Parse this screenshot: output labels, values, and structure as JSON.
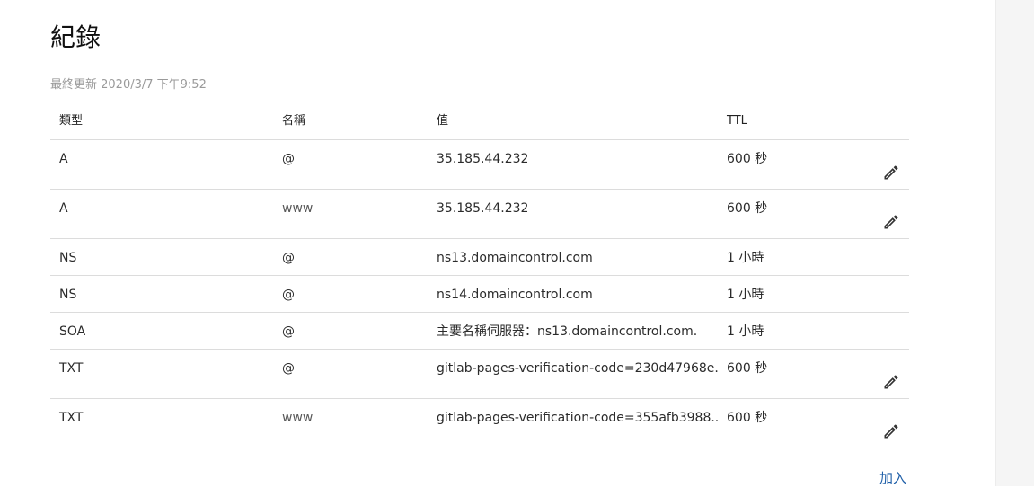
{
  "page": {
    "title": "紀錄",
    "last_updated": "最終更新 2020/3/7 下午9:52",
    "add_label": "加入"
  },
  "table": {
    "headers": {
      "type": "類型",
      "name": "名稱",
      "value": "值",
      "ttl": "TTL"
    },
    "rows": [
      {
        "type": "A",
        "name": "@",
        "value": "35.185.44.232",
        "ttl": "600 秒",
        "editable": true
      },
      {
        "type": "A",
        "name": "www",
        "value": "35.185.44.232",
        "ttl": "600 秒",
        "editable": true
      },
      {
        "type": "NS",
        "name": "@",
        "value": "ns13.domaincontrol.com",
        "ttl": "1 小時",
        "editable": false
      },
      {
        "type": "NS",
        "name": "@",
        "value": "ns14.domaincontrol.com",
        "ttl": "1 小時",
        "editable": false
      },
      {
        "type": "SOA",
        "name": "@",
        "value": "主要名稱伺服器：ns13.domaincontrol.com.",
        "ttl": "1 小時",
        "editable": false
      },
      {
        "type": "TXT",
        "name": "@",
        "value": "gitlab-pages-verification-code=230d47968e...",
        "ttl": "600 秒",
        "editable": true
      },
      {
        "type": "TXT",
        "name": "www",
        "value": "gitlab-pages-verification-code=355afb3988...",
        "ttl": "600 秒",
        "editable": true
      }
    ]
  },
  "icons": {
    "edit": "pencil-icon"
  },
  "colors": {
    "link": "#1f5fa8",
    "muted_text": "#9a9a9a",
    "divider": "#dcdcdc"
  }
}
